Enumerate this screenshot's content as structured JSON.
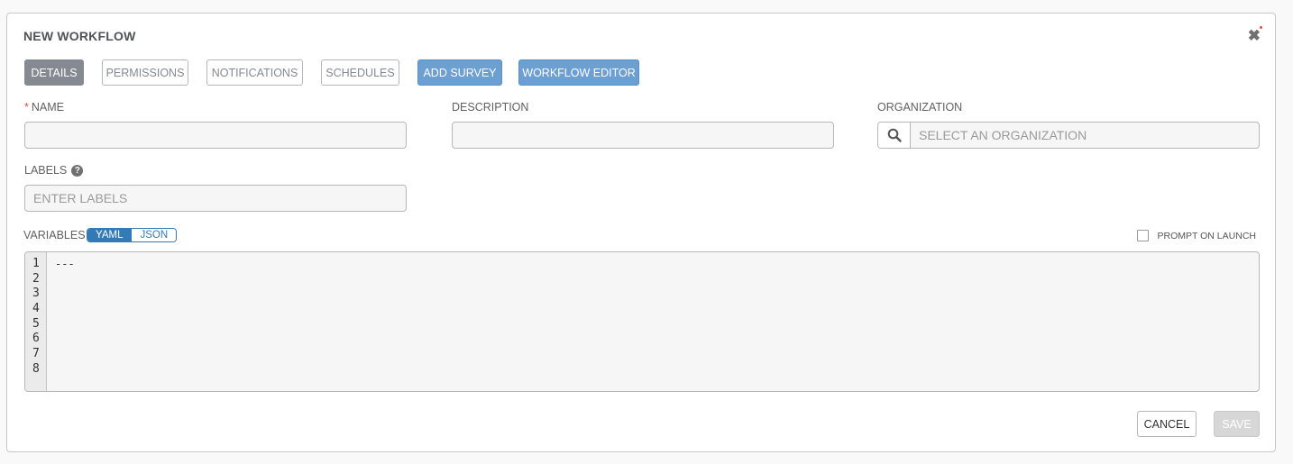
{
  "dialog": {
    "title": "NEW WORKFLOW"
  },
  "tabs": [
    {
      "label": "DETAILS"
    },
    {
      "label": "PERMISSIONS"
    },
    {
      "label": "NOTIFICATIONS"
    },
    {
      "label": "SCHEDULES"
    },
    {
      "label": "ADD SURVEY"
    },
    {
      "label": "WORKFLOW EDITOR"
    }
  ],
  "form": {
    "name_label": "NAME",
    "name_required_mark": "*",
    "name_value": "",
    "description_label": "DESCRIPTION",
    "description_value": "",
    "organization_label": "ORGANIZATION",
    "organization_placeholder": "SELECT AN ORGANIZATION",
    "labels_label": "LABELS",
    "labels_placeholder": "ENTER LABELS",
    "help_icon": "?",
    "variables_label": "VARIABLES",
    "yaml_label": "YAML",
    "json_label": "JSON",
    "prompt_on_launch_label": "PROMPT ON LAUNCH",
    "editor_lines": [
      "1",
      "2",
      "3",
      "4",
      "5",
      "6",
      "7",
      "8"
    ],
    "editor_content": "---"
  },
  "actions": {
    "cancel_label": "CANCEL",
    "save_label": "SAVE"
  },
  "icons": {
    "close": "close-icon",
    "search": "search-icon",
    "help": "help-icon"
  },
  "colors": {
    "primary": "#6c9fd2",
    "active_tab": "#848992",
    "toggle": "#337ab7",
    "required": "#d9534f"
  }
}
